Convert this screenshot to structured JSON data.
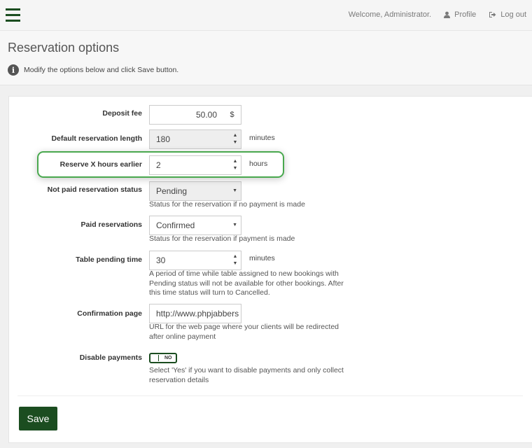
{
  "header": {
    "welcome": "Welcome, Administrator.",
    "profile_label": "Profile",
    "logout_label": "Log out"
  },
  "page": {
    "title": "Reservation options",
    "info": "Modify the options below and click Save button."
  },
  "form": {
    "deposit_fee": {
      "label": "Deposit fee",
      "value": "50.00",
      "currency": "$"
    },
    "default_length": {
      "label": "Default reservation length",
      "value": "180",
      "unit": "minutes"
    },
    "reserve_hours": {
      "label": "Reserve X hours earlier",
      "value": "2",
      "unit": "hours"
    },
    "not_paid_status": {
      "label": "Not paid reservation status",
      "value": "Pending",
      "help": "Status for the reservation if no payment is made"
    },
    "paid_reservations": {
      "label": "Paid reservations",
      "value": "Confirmed",
      "help": "Status for the reservation if payment is made"
    },
    "table_pending": {
      "label": "Table pending time",
      "value": "30",
      "unit": "minutes",
      "help_1": "A period of time while table assigned to new bookings with",
      "help_2": "Pending status will not be available for other bookings. After",
      "help_3": "this time status will turn to Cancelled."
    },
    "confirmation_page": {
      "label": "Confirmation page",
      "value": "http://www.phpjabbers",
      "help_1": "URL for the web page where your clients will be redirected",
      "help_2": "after online payment"
    },
    "disable_payments": {
      "label": "Disable payments",
      "toggle_text": "NO",
      "help_1": "Select 'Yes' if you want to disable payments and only collect",
      "help_2": "reservation details"
    }
  },
  "actions": {
    "save_label": "Save"
  },
  "colors": {
    "brand": "#1b4d20",
    "highlight": "#49a84e"
  }
}
